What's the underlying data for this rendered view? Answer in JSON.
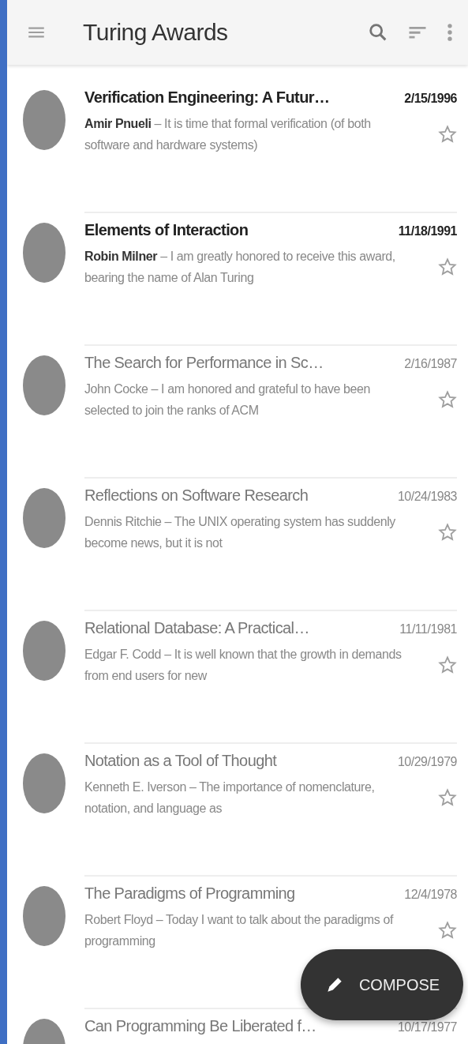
{
  "app_bar": {
    "title": "Turing Awards"
  },
  "messages": [
    {
      "title": "Verification Engineering: A Futur…",
      "date": "2/15/1996",
      "author": "Amir Pnueli",
      "preview": "– It is time that formal verification (of both software and hardware systems)",
      "unread": true,
      "starred": false
    },
    {
      "title": "Elements of Interaction",
      "date": "11/18/1991",
      "author": "Robin Milner",
      "preview": "– I am greatly honored to receive this award, bearing the name of Alan Turing",
      "unread": true,
      "starred": false
    },
    {
      "title": "The Search for Performance in Sc…",
      "date": "2/16/1987",
      "author": "John Cocke",
      "preview": "– I am honored and grateful to have been selected to join the ranks of ACM",
      "unread": false,
      "starred": false
    },
    {
      "title": "Reflections on Software Research",
      "date": "10/24/1983",
      "author": "Dennis Ritchie",
      "preview": "– The UNIX operating system has suddenly become news, but it is not",
      "unread": false,
      "starred": false
    },
    {
      "title": "Relational Database: A Practical…",
      "date": "11/11/1981",
      "author": "Edgar F. Codd",
      "preview": "– It is well known that the growth in demands from end users for new",
      "unread": false,
      "starred": false
    },
    {
      "title": "Notation as a Tool of Thought",
      "date": "10/29/1979",
      "author": "Kenneth E. Iverson",
      "preview": "– The importance of nomenclature, notation, and language as",
      "unread": false,
      "starred": false
    },
    {
      "title": "The Paradigms of Programming",
      "date": "12/4/1978",
      "author": "Robert Floyd",
      "preview": "– Today I want to talk about the paradigms of programming",
      "unread": false,
      "starred": false
    },
    {
      "title": "Can Programming Be Liberated f…",
      "date": "10/17/1977",
      "unread": false
    }
  ],
  "fab": {
    "label": "COMPOSE"
  }
}
